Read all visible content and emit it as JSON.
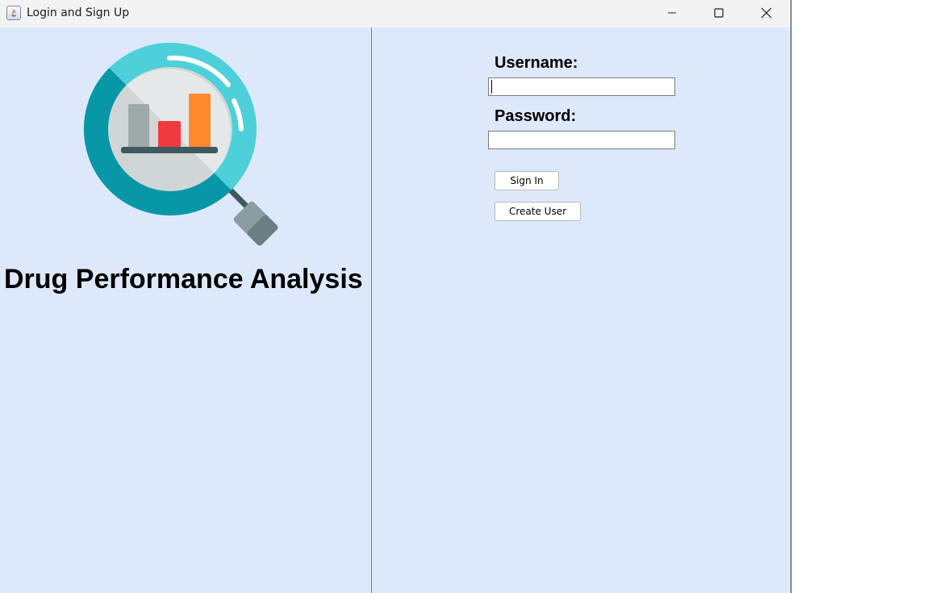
{
  "window": {
    "title": "Login and Sign Up"
  },
  "left_panel": {
    "heading": "Drug Performance Analysis",
    "logo_icon": "magnifier-bar-chart-icon"
  },
  "form": {
    "username_label": "Username:",
    "username_value": "",
    "password_label": "Password:",
    "password_value": "",
    "sign_in_label": "Sign In",
    "create_user_label": "Create User"
  },
  "colors": {
    "panel_background": "#dde9fb",
    "lens_ring": "#4dd0d9",
    "lens_ring_dark": "#0797a6",
    "bar_gray": "#9ea9a9",
    "bar_red": "#ef3a3f",
    "bar_orange": "#ff8a2d"
  }
}
